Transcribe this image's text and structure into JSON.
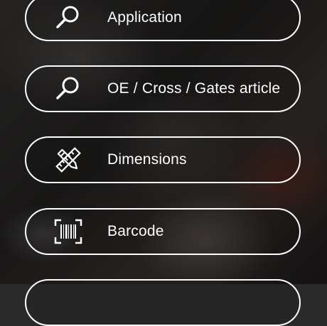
{
  "menu": {
    "items": [
      {
        "label": "Application",
        "icon": "search-icon"
      },
      {
        "label": "OE / Cross / Gates article",
        "icon": "search-icon"
      },
      {
        "label": "Dimensions",
        "icon": "ruler-pencil-icon"
      },
      {
        "label": "Barcode",
        "icon": "barcode-scan-icon"
      },
      {
        "label": "",
        "icon": ""
      }
    ]
  },
  "colors": {
    "button_border": "#ffffff",
    "text": "#ffffff"
  }
}
